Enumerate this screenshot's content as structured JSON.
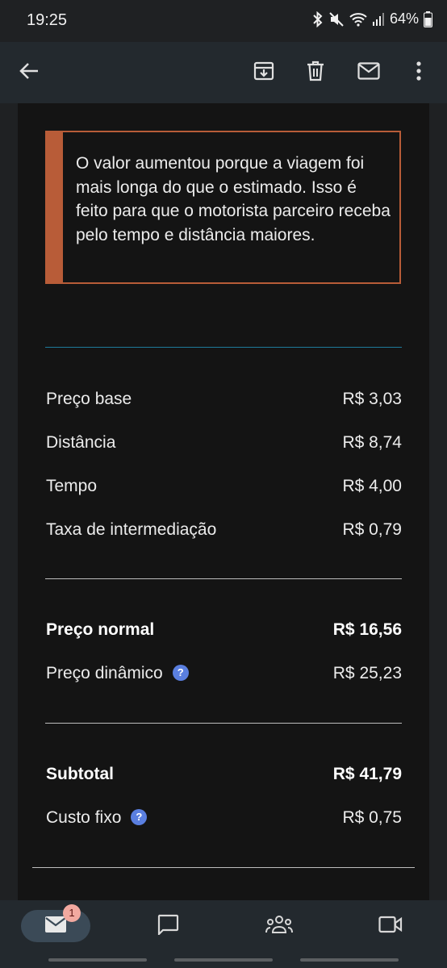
{
  "status_bar": {
    "time": "19:25",
    "battery": "64%"
  },
  "app_bar": {
    "icons": [
      "back-arrow-icon",
      "archive-icon",
      "trash-icon",
      "mail-icon",
      "more-vert-icon"
    ]
  },
  "notice": {
    "text": "O valor aumentou porque a viagem foi mais longa do que o estimado. Isso é feito para que o motorista parceiro receba pelo tempo e distância maiores."
  },
  "breakdown": [
    {
      "label": "Preço base",
      "value": "R$ 3,03"
    },
    {
      "label": "Distância",
      "value": "R$ 8,74"
    },
    {
      "label": "Tempo",
      "value": "R$ 4,00"
    },
    {
      "label": "Taxa de intermediação",
      "value": "R$ 0,79"
    }
  ],
  "normal": {
    "label": "Preço normal",
    "value": "R$ 16,56"
  },
  "dynamic": {
    "label": "Preço dinâmico",
    "value": "R$ 25,23",
    "help": "?"
  },
  "subtotal": {
    "label": "Subtotal",
    "value": "R$ 41,79"
  },
  "fixed": {
    "label": "Custo fixo",
    "value": "R$ 0,75",
    "help": "?"
  },
  "bottom_nav": {
    "mail_badge": "1",
    "items": [
      "mail-icon",
      "chat-icon",
      "spaces-icon",
      "meet-icon"
    ]
  },
  "colors": {
    "accent": "#b85c38",
    "divider_blue": "#1e7a9a",
    "help_icon": "#5a7fe0"
  }
}
